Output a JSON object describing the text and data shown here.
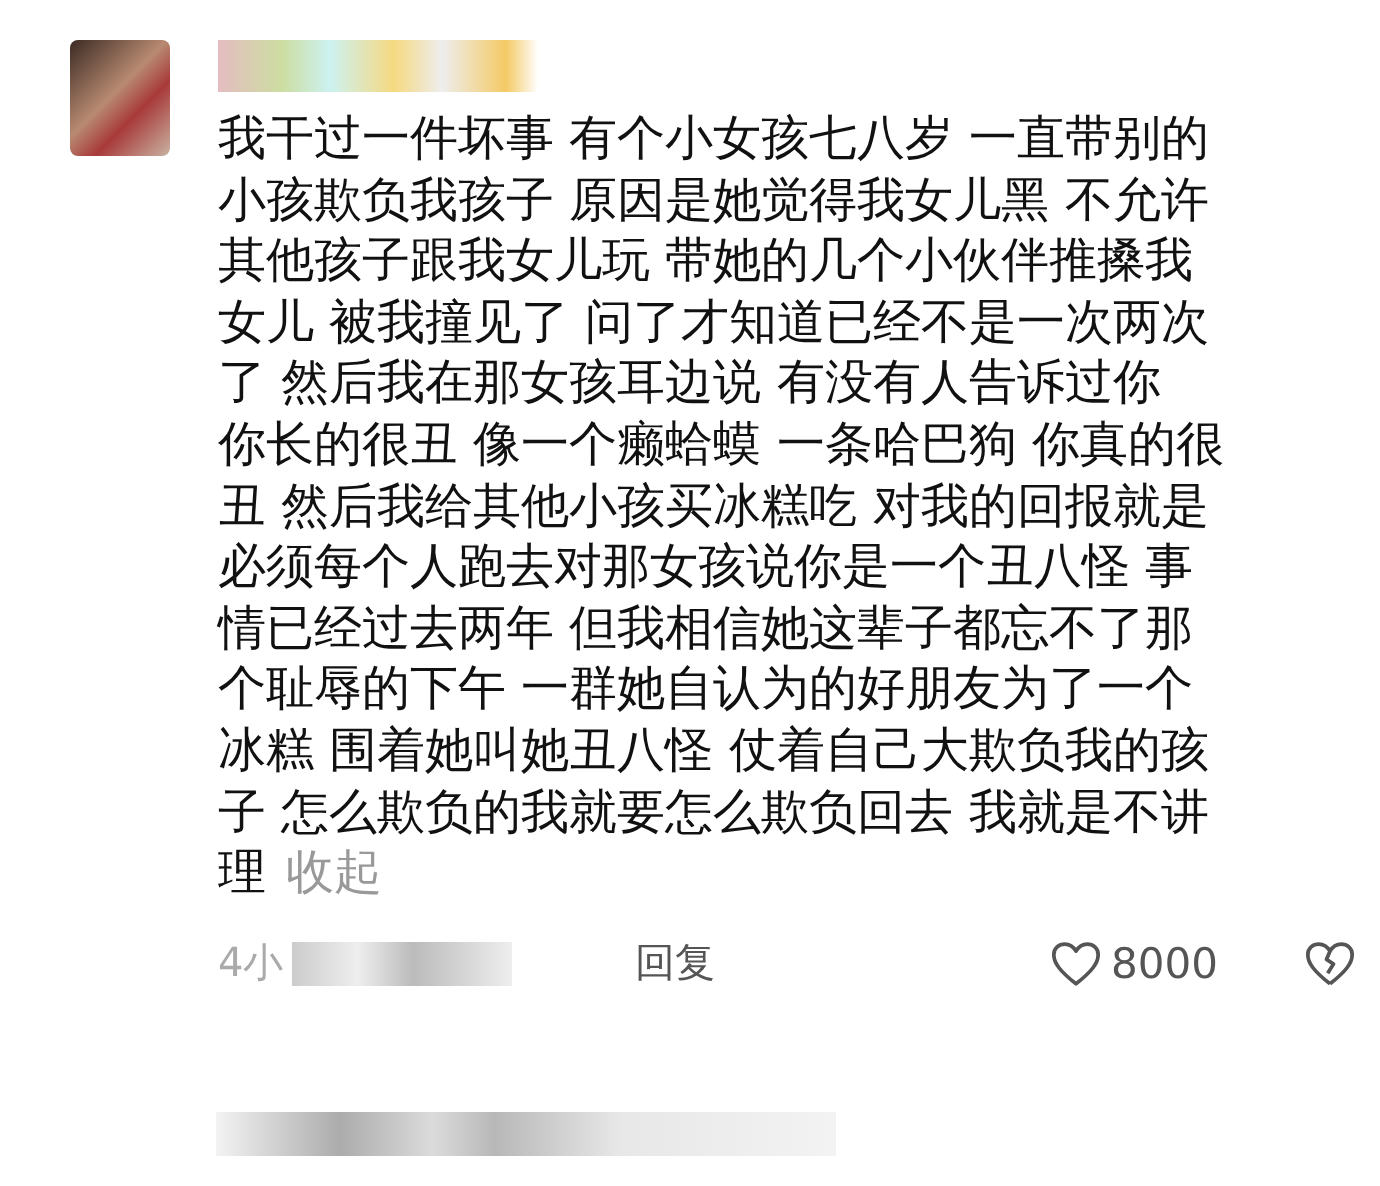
{
  "comment": {
    "lines": [
      "我干过一件坏事 有个小女孩七八岁 一直带别的",
      "小孩欺负我孩子 原因是她觉得我女儿黑 不允许",
      "其他孩子跟我女儿玩 带她的几个小伙伴推搡我",
      "女儿 被我撞见了 问了才知道已经不是一次两次",
      "了 然后我在那女孩耳边说 有没有人告诉过你",
      "你长的很丑 像一个癞蛤蟆 一条哈巴狗 你真的很",
      "丑 然后我给其他小孩买冰糕吃 对我的回报就是",
      "必须每个人跑去对那女孩说你是一个丑八怪 事",
      "情已经过去两年 但我相信她这辈子都忘不了那",
      "个耻辱的下午 一群她自认为的好朋友为了一个",
      "冰糕 围着她叫她丑八怪 仗着自己大欺负我的孩",
      "子 怎么欺负的我就要怎么欺负回去 我就是不讲",
      "理"
    ],
    "collapse": "收起",
    "time": "4小",
    "reply": "回复",
    "likes": "8000"
  }
}
